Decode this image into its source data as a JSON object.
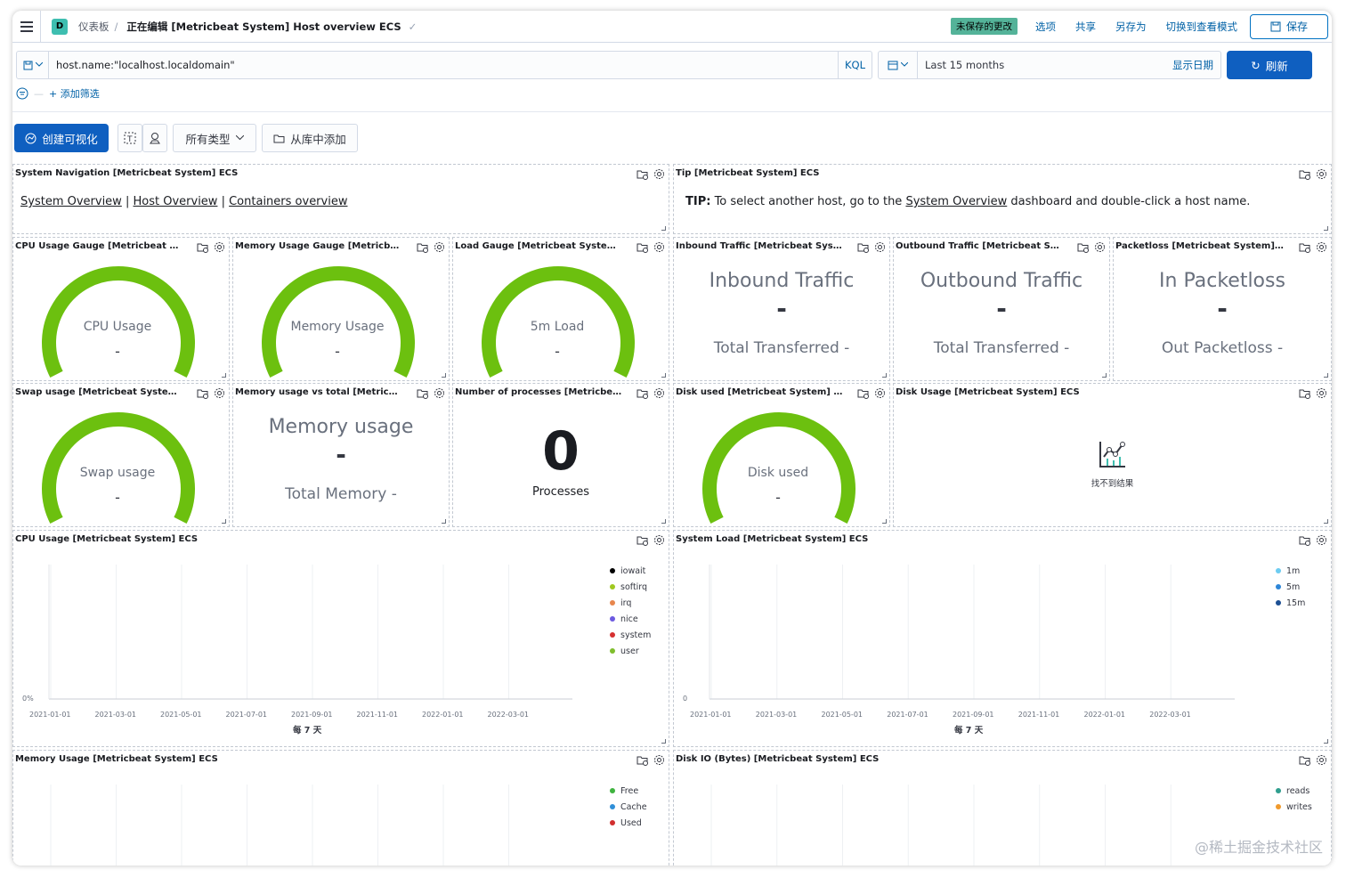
{
  "header": {
    "space_letter": "D",
    "breadcrumb_root": "仪表板",
    "breadcrumb_current": "正在编辑 [Metricbeat System] Host overview ECS",
    "unsaved_badge": "未保存的更改",
    "links": [
      "选项",
      "共享",
      "另存为",
      "切换到查看模式"
    ],
    "save_label": "保存"
  },
  "query": {
    "value": "host.name:\"localhost.localdomain\"",
    "language": "KQL",
    "time_range": "Last 15 months",
    "show_dates": "显示日期",
    "refresh_label": "刷新"
  },
  "filters": {
    "add_label": "+ 添加筛选"
  },
  "toolbar": {
    "create_label": "创建可视化",
    "all_types_label": "所有类型",
    "add_from_library_label": "从库中添加"
  },
  "panels": {
    "nav": {
      "title": "System Navigation [Metricbeat System] ECS",
      "links": [
        "System Overview",
        "Host Overview",
        "Containers overview"
      ],
      "separator": "|"
    },
    "tip": {
      "title": "Tip [Metricbeat System] ECS",
      "lead": "TIP:",
      "text_before": "To select another host, go to the",
      "link": "System Overview",
      "text_after": "dashboard and double-click a host name."
    },
    "cpu_gauge": {
      "title": "CPU Usage Gauge [Metricbeat Syste...",
      "label": "CPU Usage",
      "value": "-"
    },
    "mem_gauge": {
      "title": "Memory Usage Gauge [Metricbeat Sy...",
      "label": "Memory Usage",
      "value": "-"
    },
    "load_gauge": {
      "title": "Load Gauge [Metricbeat System] ECS",
      "label": "5m Load",
      "value": "-"
    },
    "inbound": {
      "title": "Inbound Traffic [Metricbeat System] E...",
      "label": "Inbound Traffic",
      "value": "-",
      "sub": "Total Transferred -"
    },
    "outbound": {
      "title": "Outbound Traffic [Metricbeat System...",
      "label": "Outbound Traffic",
      "value": "-",
      "sub": "Total Transferred -"
    },
    "packetloss": {
      "title": "Packetloss [Metricbeat System] ECS",
      "label": "In Packetloss",
      "value": "-",
      "sub": "Out Packetloss -"
    },
    "swap": {
      "title": "Swap usage [Metricbeat System] ECS",
      "label": "Swap usage",
      "value": "-"
    },
    "mem_total": {
      "title": "Memory usage vs total [Metricbeat Sy...",
      "label": "Memory usage",
      "value": "-",
      "sub": "Total Memory -"
    },
    "processes": {
      "title": "Number of processes [Metricbeat Sys...",
      "value": "0",
      "label": "Processes"
    },
    "disk_used": {
      "title": "Disk used [Metricbeat System] ECS",
      "label": "Disk used",
      "value": "-"
    },
    "disk_usage": {
      "title": "Disk Usage [Metricbeat System] ECS",
      "no_results": "找不到结果"
    },
    "cpu_usage": {
      "title": "CPU Usage [Metricbeat System] ECS"
    },
    "system_load": {
      "title": "System Load [Metricbeat System] ECS"
    },
    "memory_usage": {
      "title": "Memory Usage [Metricbeat System] ECS"
    },
    "disk_io": {
      "title": "Disk IO (Bytes) [Metricbeat System] ECS"
    }
  },
  "chart_data": [
    {
      "type": "area",
      "title": "CPU Usage [Metricbeat System] ECS",
      "xlabel": "每 7 天",
      "ylabel": "",
      "x_ticks": [
        "2021-01-01",
        "2021-03-01",
        "2021-05-01",
        "2021-07-01",
        "2021-09-01",
        "2021-11-01",
        "2022-01-01",
        "2022-03-01"
      ],
      "y_ticks": [
        "0%"
      ],
      "legend_position": "right",
      "series": [
        {
          "name": "iowait",
          "color": "#000000",
          "values": []
        },
        {
          "name": "softirq",
          "color": "#a0c81f",
          "values": []
        },
        {
          "name": "irq",
          "color": "#e7864d",
          "values": []
        },
        {
          "name": "nice",
          "color": "#6c5ae0",
          "values": []
        },
        {
          "name": "system",
          "color": "#d63030",
          "values": []
        },
        {
          "name": "user",
          "color": "#7fbe2d",
          "values": []
        }
      ]
    },
    {
      "type": "line",
      "title": "System Load [Metricbeat System] ECS",
      "xlabel": "每 7 天",
      "ylabel": "",
      "x_ticks": [
        "2021-01-01",
        "2021-03-01",
        "2021-05-01",
        "2021-07-01",
        "2021-09-01",
        "2021-11-01",
        "2022-01-01",
        "2022-03-01"
      ],
      "y_ticks": [
        "0"
      ],
      "legend_position": "right",
      "series": [
        {
          "name": "1m",
          "color": "#6dccf1",
          "values": []
        },
        {
          "name": "5m",
          "color": "#2d86d8",
          "values": []
        },
        {
          "name": "15m",
          "color": "#1c4f93",
          "values": []
        }
      ]
    },
    {
      "type": "area",
      "title": "Memory Usage [Metricbeat System] ECS",
      "legend_position": "right",
      "series": [
        {
          "name": "Free",
          "color": "#3fb33f",
          "values": []
        },
        {
          "name": "Cache",
          "color": "#2f8fd8",
          "values": []
        },
        {
          "name": "Used",
          "color": "#d12e2e",
          "values": []
        }
      ]
    },
    {
      "type": "line",
      "title": "Disk IO (Bytes) [Metricbeat System] ECS",
      "legend_position": "right",
      "series": [
        {
          "name": "reads",
          "color": "#2f9e8e",
          "values": []
        },
        {
          "name": "writes",
          "color": "#f09a2d",
          "values": []
        }
      ]
    }
  ],
  "colors": {
    "gauge": "#6cc00f",
    "primary": "#0f5fc0",
    "link": "#0061a6"
  },
  "watermark": "@稀土掘金技术社区"
}
